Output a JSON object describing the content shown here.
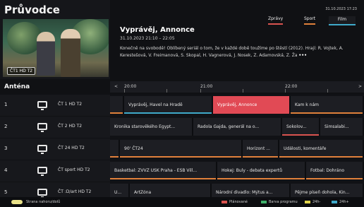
{
  "app": {
    "title": "Průvodce",
    "datetime": "31.10.2023 17:23"
  },
  "preview": {
    "badge": "ČT1 HD T2"
  },
  "filters": {
    "zpravy": "Zprávy",
    "sport": "Sport",
    "film": "Film"
  },
  "colors": {
    "zpravy": "#d9534f",
    "sport": "#e0803b",
    "film": "#3fa9c9",
    "selected": "#e14a55",
    "planovane": "#d9534f",
    "barva_programu": "#3fb06a",
    "plus24": "#e0d34a",
    "plus24_2": "#3fa9c9"
  },
  "show": {
    "title": "Vyprávěj, Annonce",
    "time": "31.10.2023 21:10 – 22:05",
    "description": "Konečně na svobodě! Oblíbený seriál o tom, že v každé době toužíme po štěstí (2012). Hrají: R. Vojtek, A. Kerestešová, V. Freimanová, S. Skopal, H. Vagnerová, J. Nosek, Z. Adamovská, Z. Ža",
    "more": "•••"
  },
  "grid": {
    "label": "Anténa",
    "timebar": {
      "prev": "<",
      "t1": "20:00",
      "t2": "21:00",
      "t3": "22:00",
      "next": ">"
    }
  },
  "channels": [
    {
      "num": "1",
      "name": "ČT 1 HD T2",
      "programs": [
        {
          "title": "",
          "color": ""
        },
        {
          "title": "Vyprávěj, Havel na Hradě",
          "color": "#3fa9c9"
        },
        {
          "title": "Vyprávěj, Annonce",
          "color": ""
        },
        {
          "title": "Kam k nám",
          "color": ""
        }
      ]
    },
    {
      "num": "2",
      "name": "ČT 2 HD T2",
      "programs": [
        {
          "title": "Kronika starověkého Egypt...",
          "color": ""
        },
        {
          "title": "Radola Gajda, generál na o...",
          "color": ""
        },
        {
          "title": "Sokolov...",
          "color": "#d9534f"
        },
        {
          "title": "Simsalabi...",
          "color": ""
        }
      ]
    },
    {
      "num": "3",
      "name": "ČT 24 HD T2",
      "programs": [
        {
          "title": "",
          "color": ""
        },
        {
          "title": "90' ČT24",
          "color": ""
        },
        {
          "title": "Horizont ...",
          "color": ""
        },
        {
          "title": "Události, komentáře",
          "color": ""
        }
      ]
    },
    {
      "num": "4",
      "name": "ČT sport HD T2",
      "programs": [
        {
          "title": "Basketbal: ZVVZ USK Praha - ESB Vill...",
          "color": ""
        },
        {
          "title": "Hokej: Buly - debata expertů",
          "color": ""
        },
        {
          "title": "Fotbal: Dohráno",
          "color": ""
        }
      ]
    },
    {
      "num": "5",
      "name": "ČT :D/art HD T2",
      "programs": [
        {
          "title": "U...",
          "color": ""
        },
        {
          "title": "ArtZóna",
          "color": ""
        },
        {
          "title": "Národní divadlo: Mýtus a...",
          "color": ""
        },
        {
          "title": "Pějme píseň dohola, Kin...",
          "color": ""
        }
      ]
    }
  ],
  "footer": {
    "hint": "Strana nahoru/dolů",
    "legend": {
      "planovane": "Plánované",
      "barva": "Barva programu",
      "p24": "24h-",
      "p24b": "24h+"
    }
  }
}
